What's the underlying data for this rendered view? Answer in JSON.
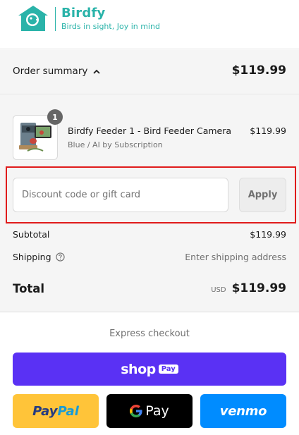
{
  "brand": {
    "name": "Birdfy",
    "tagline": "Birds in sight, Joy in mind",
    "color": "#2ab3a9"
  },
  "summary": {
    "toggle_label": "Order summary",
    "toggle_icon": "chevron-up-icon",
    "total": "$119.99"
  },
  "item": {
    "quantity": "1",
    "title": "Birdfy Feeder 1 - Bird Feeder Camera",
    "variant": "Blue / AI by Subscription",
    "price": "$119.99"
  },
  "discount": {
    "placeholder": "Discount code or gift card",
    "apply_label": "Apply"
  },
  "totals": {
    "subtotal_label": "Subtotal",
    "subtotal_value": "$119.99",
    "shipping_label": "Shipping",
    "shipping_icon": "help-circle-icon",
    "shipping_value": "Enter shipping address",
    "total_label": "Total",
    "currency": "USD",
    "total_value": "$119.99"
  },
  "express": {
    "title": "Express checkout",
    "shop_word": "shop",
    "shop_pay_pill": "Pay",
    "paypal_part1": "Pay",
    "paypal_part2": "Pal",
    "gpay_label": "Pay",
    "venmo_label": "venmo"
  },
  "colors": {
    "shop_pay": "#5a31f4",
    "paypal": "#ffc439",
    "google_pay": "#000000",
    "venmo": "#008cff",
    "highlight_frame": "#e01b1b"
  }
}
